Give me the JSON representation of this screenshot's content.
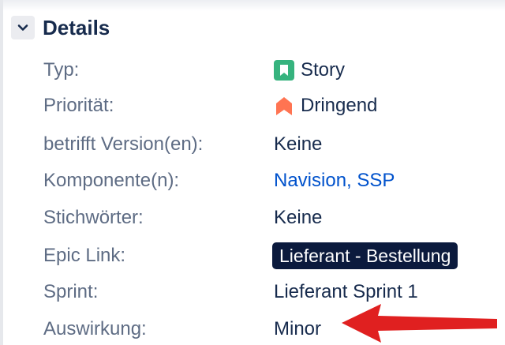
{
  "section": {
    "title": "Details"
  },
  "fields": {
    "type": {
      "label": "Typ:",
      "value": "Story",
      "icon": "story-icon",
      "icon_color": "#36b37e"
    },
    "priority": {
      "label": "Priorität:",
      "value": "Dringend",
      "icon": "priority-urgent-icon",
      "icon_color": "#ff7452"
    },
    "affects_version": {
      "label": "betrifft Version(en):",
      "value": "Keine"
    },
    "components": {
      "label": "Komponente(n):",
      "links": [
        "Navision",
        "SSP"
      ],
      "separator": ", "
    },
    "labels": {
      "label": "Stichwörter:",
      "value": "Keine"
    },
    "epic_link": {
      "label": "Epic Link:",
      "value": "Lieferant - Bestellung",
      "badge_color": "#0b1a3d"
    },
    "sprint": {
      "label": "Sprint:",
      "value": "Lieferant Sprint 1"
    },
    "impact": {
      "label": "Auswirkung:",
      "value": "Minor"
    }
  },
  "annotation": {
    "icon": "red-arrow-icon",
    "color": "#e02020"
  }
}
